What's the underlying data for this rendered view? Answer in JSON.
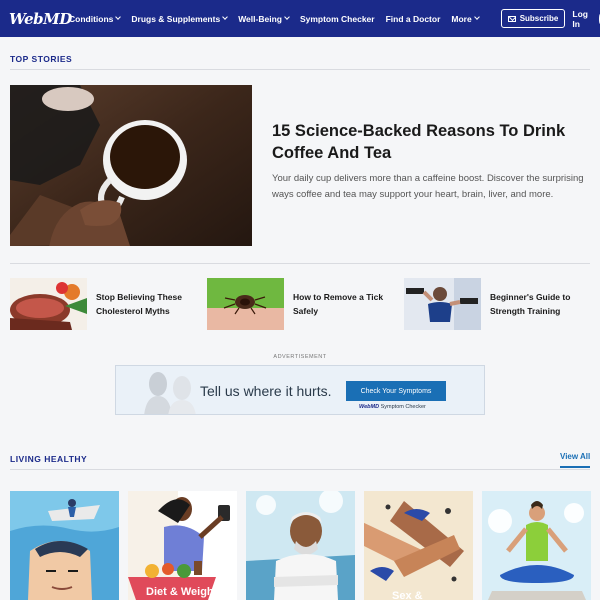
{
  "nav": {
    "logo": "WebMD",
    "items": [
      {
        "label": "Conditions",
        "dropdown": true
      },
      {
        "label": "Drugs & Supplements",
        "dropdown": true
      },
      {
        "label": "Well-Being",
        "dropdown": true
      },
      {
        "label": "Symptom Checker",
        "dropdown": false
      },
      {
        "label": "Find a Doctor",
        "dropdown": false
      },
      {
        "label": "More",
        "dropdown": true
      }
    ],
    "subscribe": "Subscribe",
    "login": "Log In",
    "search_icon": "search-icon",
    "bg_color": "#1b2a8a"
  },
  "top_stories": {
    "heading": "TOP STORIES",
    "hero": {
      "title": "15 Science-Backed Reasons To Drink Coffee And Tea",
      "description": "Your daily cup delivers more than a caffeine boost. Discover the surprising ways coffee and tea may support your heart, brain, liver, and more."
    },
    "stories": [
      {
        "title": "Stop Believing These Cholesterol Myths"
      },
      {
        "title": "How to Remove a Tick Safely"
      },
      {
        "title": "Beginner's Guide to Strength Training"
      }
    ]
  },
  "ad": {
    "label": "ADVERTISEMENT",
    "headline": "Tell us where it hurts.",
    "button": "Check Your Symptoms",
    "brand": "WebMD",
    "brand_suffix": "Symptom Checker"
  },
  "living_healthy": {
    "heading": "LIVING HEALTHY",
    "view_all": "View All",
    "cards": [
      {
        "illustration": "man-boat-head"
      },
      {
        "illustration": "woman-grocery-basket",
        "partial_text": "Diet & Weight"
      },
      {
        "illustration": "older-man-towel"
      },
      {
        "illustration": "hands-birds",
        "partial_text": "Sex &"
      },
      {
        "illustration": "woman-meditating"
      }
    ]
  },
  "colors": {
    "accent": "#1b2a8a",
    "link": "#1a6fb5",
    "background": "#f5f6f8"
  }
}
